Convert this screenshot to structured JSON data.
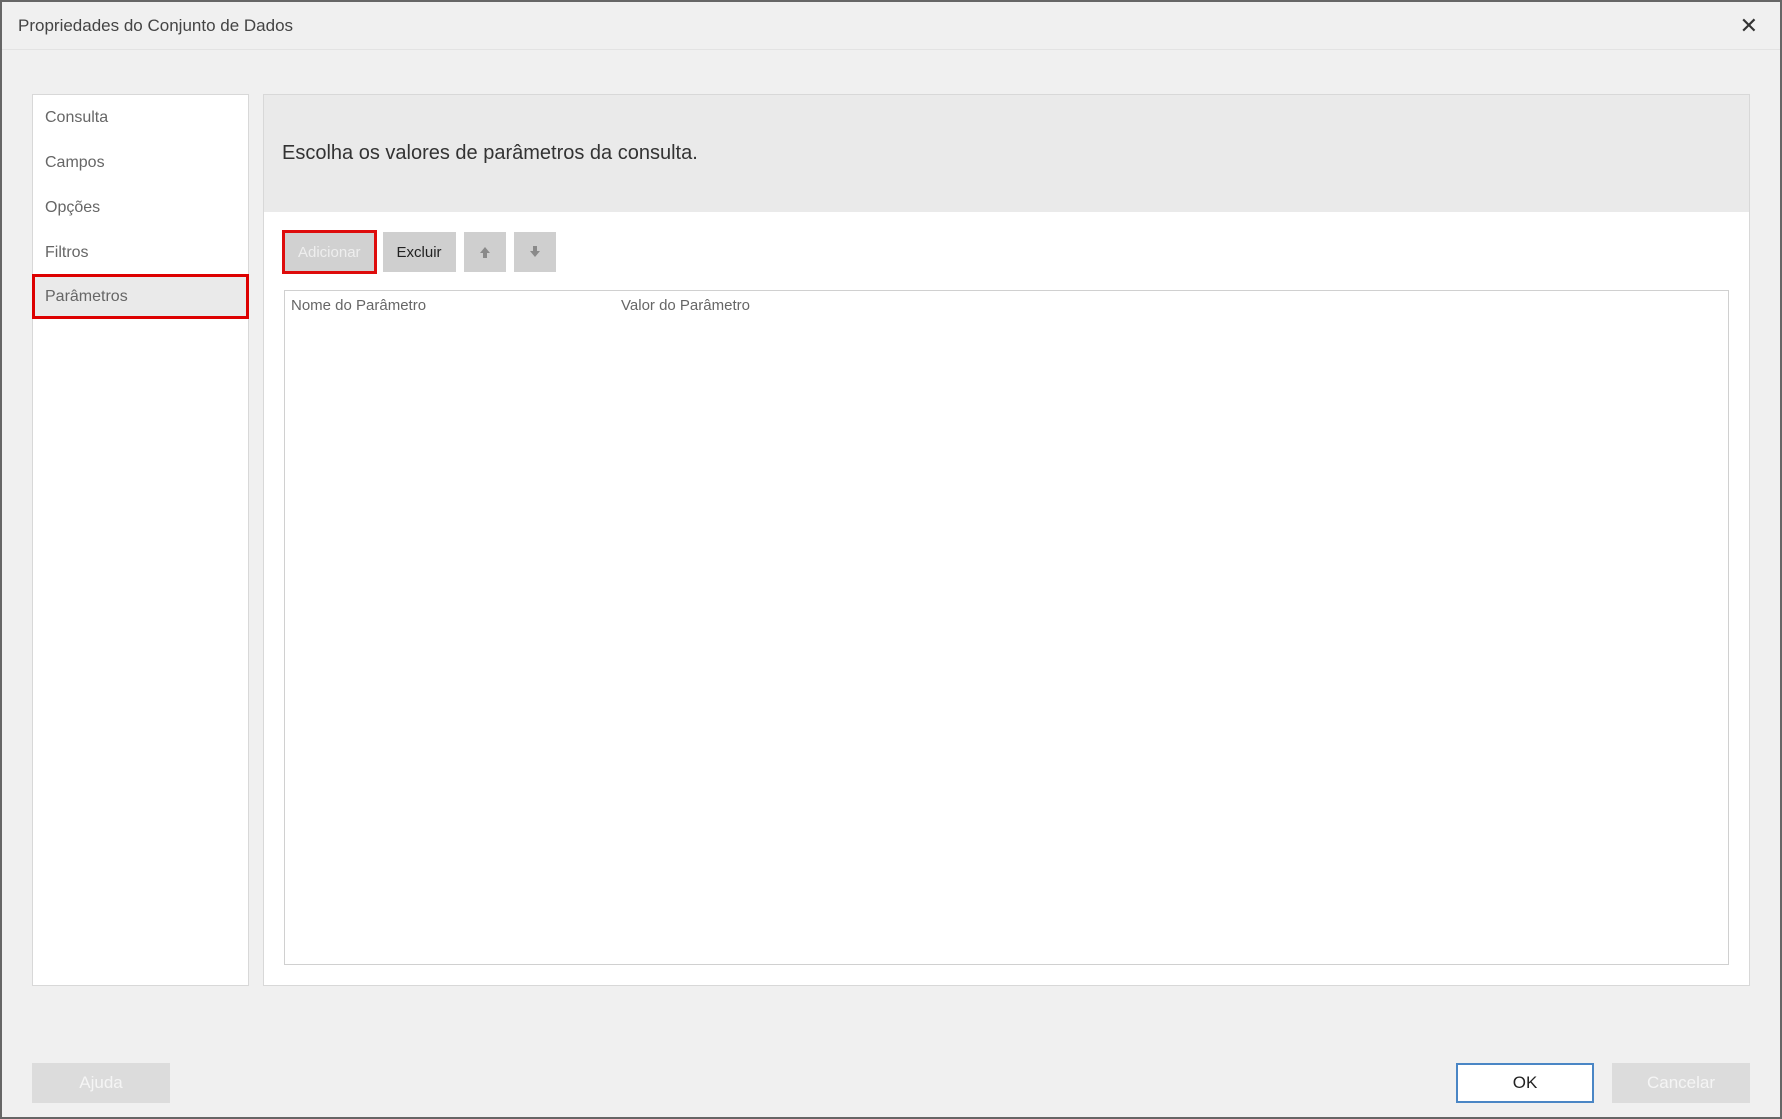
{
  "dialog": {
    "title": "Propriedades do Conjunto de Dados"
  },
  "sidebar": {
    "items": [
      {
        "label": "Consulta"
      },
      {
        "label": "Campos"
      },
      {
        "label": "Opções"
      },
      {
        "label": "Filtros"
      },
      {
        "label": "Parâmetros"
      }
    ]
  },
  "main": {
    "instruction": "Escolha os valores de parâmetros da consulta.",
    "toolbar": {
      "add_label": "Adicionar",
      "delete_label": "Excluir"
    },
    "grid": {
      "col_name": "Nome do Parâmetro",
      "col_value": "Valor do Parâmetro"
    }
  },
  "footer": {
    "help_label": "Ajuda",
    "ok_label": "OK",
    "cancel_label": "Cancelar"
  }
}
